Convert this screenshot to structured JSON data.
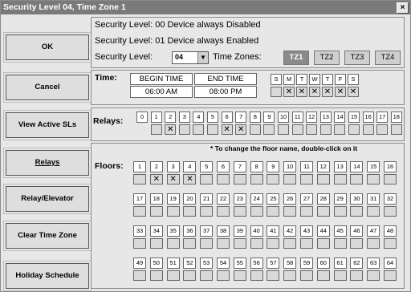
{
  "window": {
    "title": "Security Level 04, Time Zone 1",
    "close": "×"
  },
  "sidebar": [
    {
      "label": "OK",
      "name": "ok-button"
    },
    {
      "label": "Cancel",
      "name": "cancel-button"
    },
    {
      "label": "View Active SLs",
      "name": "view-active-sls-button"
    },
    {
      "label": "Relays",
      "name": "relays-button"
    },
    {
      "label": "Relay/Elevator",
      "name": "relay-elevator-button"
    },
    {
      "label": "Clear Time Zone",
      "name": "clear-time-zone-button"
    },
    {
      "label": "Holiday Schedule",
      "name": "holiday-schedule-button"
    }
  ],
  "security": {
    "line1": "Security Level:  00 Device always Disabled",
    "line2": "Security Level:  01 Device always Enabled",
    "line3_label": "Security Level:",
    "level_value": "04",
    "combo_arrow": "▼",
    "tz_label": "Time Zones:",
    "time_zones": [
      "TZ1",
      "TZ2",
      "TZ3",
      "TZ4"
    ],
    "active_tz": "TZ1"
  },
  "time": {
    "label": "Time:",
    "begin_header": "BEGIN TIME",
    "end_header": "END TIME",
    "begin": "06:00 AM",
    "end": "08:00 PM",
    "days": [
      "S",
      "M",
      "T",
      "W",
      "T",
      "F",
      "S"
    ],
    "days_checked": [
      false,
      true,
      true,
      true,
      true,
      true,
      true
    ]
  },
  "relays": {
    "label": "Relays:",
    "numbers": [
      "0",
      "1",
      "2",
      "3",
      "4",
      "5",
      "6",
      "7",
      "8",
      "9",
      "10",
      "11",
      "12",
      "13",
      "14",
      "15",
      "16",
      "17",
      "18"
    ],
    "checked": [
      null,
      false,
      true,
      false,
      false,
      false,
      true,
      true,
      false,
      false,
      false,
      false,
      false,
      false,
      false,
      false,
      false,
      false,
      false
    ]
  },
  "floors": {
    "label": "Floors:",
    "note": "* To change the floor name, double-click on it",
    "checked_floors": [
      2,
      3,
      4
    ],
    "rows": [
      [
        "1",
        "2",
        "3",
        "4",
        "5",
        "6",
        "7",
        "8",
        "9",
        "10",
        "11",
        "12",
        "13",
        "14",
        "15",
        "16"
      ],
      [
        "17",
        "18",
        "19",
        "20",
        "21",
        "22",
        "23",
        "24",
        "25",
        "26",
        "27",
        "28",
        "29",
        "30",
        "31",
        "32"
      ],
      [
        "33",
        "34",
        "35",
        "36",
        "37",
        "38",
        "39",
        "40",
        "41",
        "42",
        "43",
        "44",
        "45",
        "46",
        "47",
        "48"
      ],
      [
        "49",
        "50",
        "51",
        "52",
        "53",
        "54",
        "55",
        "56",
        "57",
        "58",
        "59",
        "60",
        "61",
        "62",
        "63",
        "64"
      ]
    ]
  },
  "check_mark": "✕"
}
